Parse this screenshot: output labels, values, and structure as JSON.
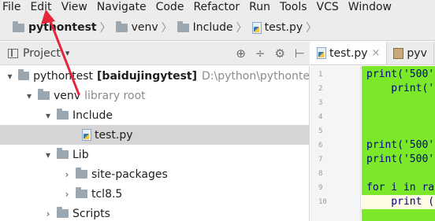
{
  "menu": [
    "File",
    "Edit",
    "View",
    "Navigate",
    "Code",
    "Refactor",
    "Run",
    "Tools",
    "VCS",
    "Window"
  ],
  "breadcrumb": {
    "project": "pythontest",
    "folder": "venv",
    "subfolder": "Include",
    "file": "test.py"
  },
  "project_panel": {
    "title": "Project",
    "dropdown": "▾",
    "tools": [
      "⊕",
      "÷",
      "⚙",
      "⊢"
    ]
  },
  "tabs": [
    {
      "label": "test.py",
      "active": true,
      "close": "×"
    },
    {
      "label": "pyv",
      "active": false
    }
  ],
  "tree": [
    {
      "arrow": "▾",
      "label": "pythontest",
      "bold_label": "[baidujingytest]",
      "extra": "D:\\python\\pythonte"
    },
    {
      "arrow": "▾",
      "label": "venv",
      "extra": "library root"
    },
    {
      "arrow": "▾",
      "label": "Include"
    },
    {
      "arrow": "",
      "label": "test.py"
    },
    {
      "arrow": "▾",
      "label": "Lib"
    },
    {
      "arrow": "›",
      "label": "site-packages"
    },
    {
      "arrow": "›",
      "label": "tcl8.5"
    },
    {
      "arrow": "›",
      "label": "Scripts"
    }
  ],
  "line_numbers": [
    "1",
    "2",
    "3",
    "4",
    "5",
    "6",
    "7",
    "8",
    "9",
    "10"
  ],
  "code": {
    "l1": "print('500'",
    "l2": "    print('",
    "l6": "print('500'",
    "l7": "print('500'",
    "l9": "for i in ra",
    "l10": "    print ("
  },
  "colors": {
    "highlight": "#7ce82a",
    "annotation_arrow": "#e6243c",
    "selection": "#d5d5d5"
  }
}
